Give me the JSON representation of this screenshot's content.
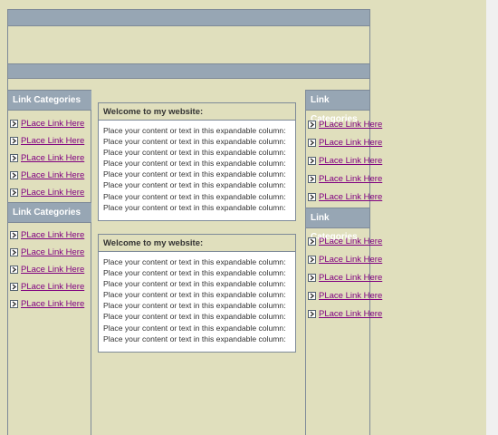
{
  "left_sidebar": {
    "sections": [
      {
        "title": "Link Categories",
        "links": [
          "PLace Link Here",
          "PLace Link Here",
          "PLace Link Here",
          "PLace Link Here",
          "PLace Link Here"
        ]
      },
      {
        "title": "Link Categories",
        "links": [
          "PLace Link Here",
          "PLace Link Here",
          "PLace Link Here",
          "PLace Link Here",
          "PLace Link Here"
        ]
      }
    ]
  },
  "right_sidebar": {
    "sections": [
      {
        "title": "Link Categories",
        "links": [
          "PLace Link Here",
          "PLace Link Here",
          "PLace Link Here",
          "PLace Link Here",
          "PLace Link Here"
        ]
      },
      {
        "title": "Link Categories",
        "links": [
          "PLace Link Here",
          "PLace Link Here",
          "PLace Link Here",
          "PLace Link Here",
          "PLace Link Here"
        ]
      }
    ]
  },
  "main": {
    "boxes": [
      {
        "title": "Welcome to my website:",
        "body": "Place your content or text in this expandable column: Place your content or text in this expandable column: Place your content or text in this expandable column: Place your content or text in this expandable column: Place your content or text in this expandable column: Place your content or text in this expandable column: Place your content or text in this expandable column: Place your content or text in this expandable column:"
      },
      {
        "title": "Welcome to my website:",
        "body": "Place your content or text in this expandable column: Place your content or text in this expandable column: Place your content or text in this expandable column: Place your content or text in this expandable column: Place your content or text in this expandable column: Place your content or text in this expandable column: Place your content or text in this expandable column: Place your content or text in this expandable column:"
      }
    ]
  },
  "icons": {
    "link_bullet": "arrow-right-icon"
  },
  "colors": {
    "background": "#e0dfbd",
    "bar": "#97a6b4",
    "border": "#7e8a98",
    "link": "#800080",
    "content_bg": "#ffffff"
  }
}
